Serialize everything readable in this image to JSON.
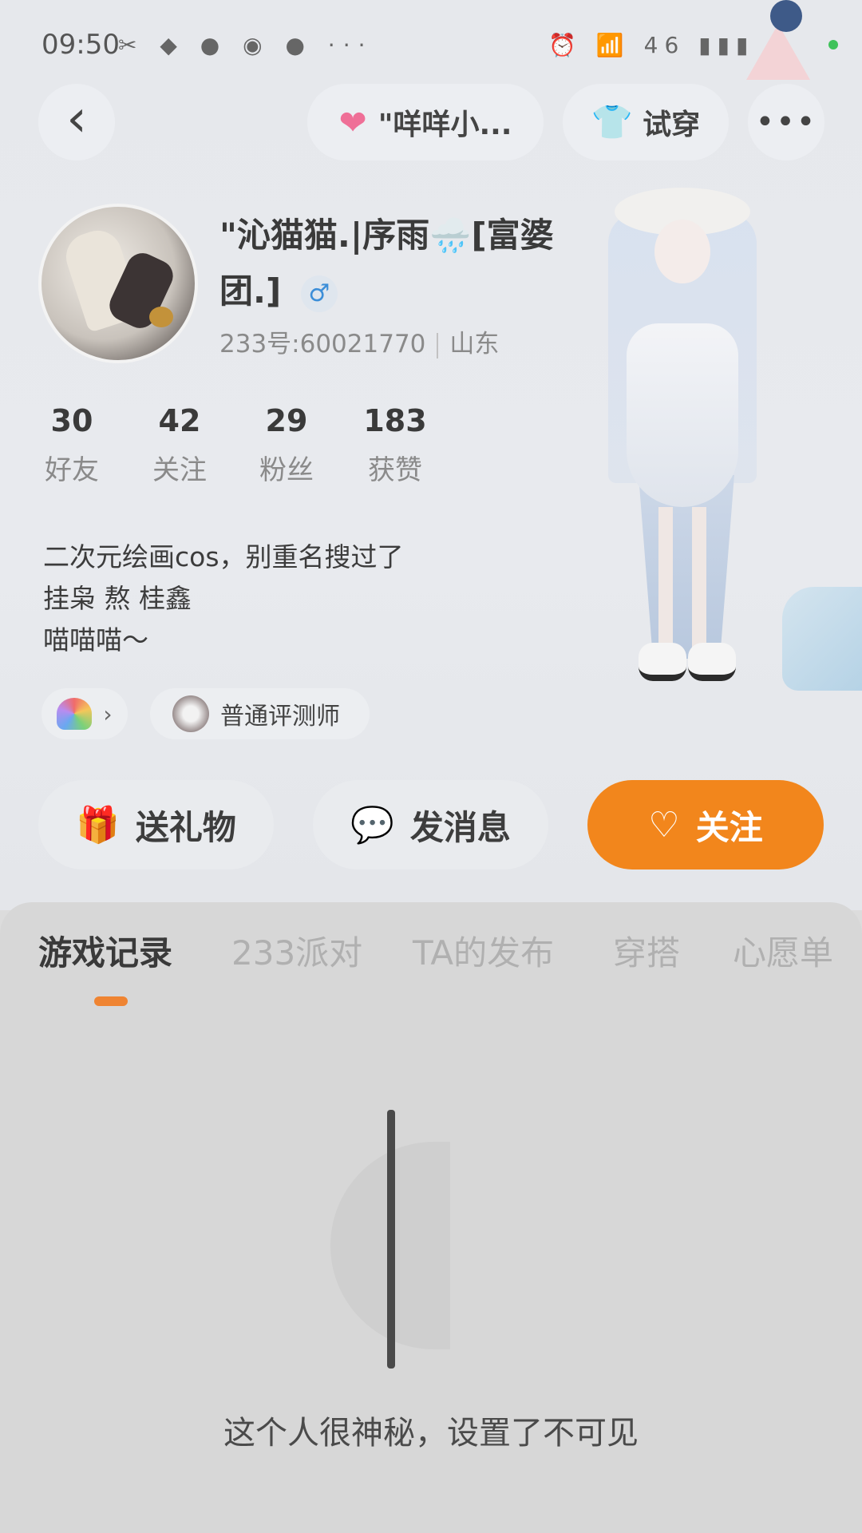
{
  "status_bar": {
    "time": "09:50",
    "left_icons": "✂ ◆ ● ◉ ● ···",
    "right_icons": "⏰ 📶 46 ▮▮▮ ⚡",
    "network": "46"
  },
  "header": {
    "back_icon": "‹",
    "friend_pill_label": "\"咩咩小...",
    "tryon_label": "试穿",
    "more_icon": "•••"
  },
  "profile": {
    "name": "\"沁猫猫.|序雨🌧️[富婆团.]",
    "gender_icon": "♂",
    "uid": "233号:60021770",
    "region": "山东"
  },
  "stats": [
    {
      "num": "30",
      "label": "好友"
    },
    {
      "num": "42",
      "label": "关注"
    },
    {
      "num": "29",
      "label": "粉丝"
    },
    {
      "num": "183",
      "label": "获赞"
    }
  ],
  "bio": {
    "line1": "二次元绘画cos，别重名搜过了",
    "line2": "挂枭 熬 桂鑫",
    "line3": "喵喵喵～"
  },
  "badges": {
    "badge1_chevron": "›",
    "evaluator_label": "普通评测师"
  },
  "actions": {
    "gift_label": "送礼物",
    "gift_icon": "🎁",
    "message_label": "发消息",
    "message_icon": "💬",
    "follow_label": "关注",
    "follow_icon": "♡"
  },
  "tabs": [
    {
      "label": "游戏记录",
      "active": true
    },
    {
      "label": "233派对",
      "active": false
    },
    {
      "label": "TA的发布",
      "active": false
    },
    {
      "label": "穿搭",
      "active": false
    },
    {
      "label": "心愿单",
      "active": false
    }
  ],
  "empty_state": {
    "text": "这个人很神秘，设置了不可见"
  },
  "colors": {
    "accent": "#f2861c",
    "tab_indicator": "#ef8432",
    "background": "#dcdcdc"
  }
}
